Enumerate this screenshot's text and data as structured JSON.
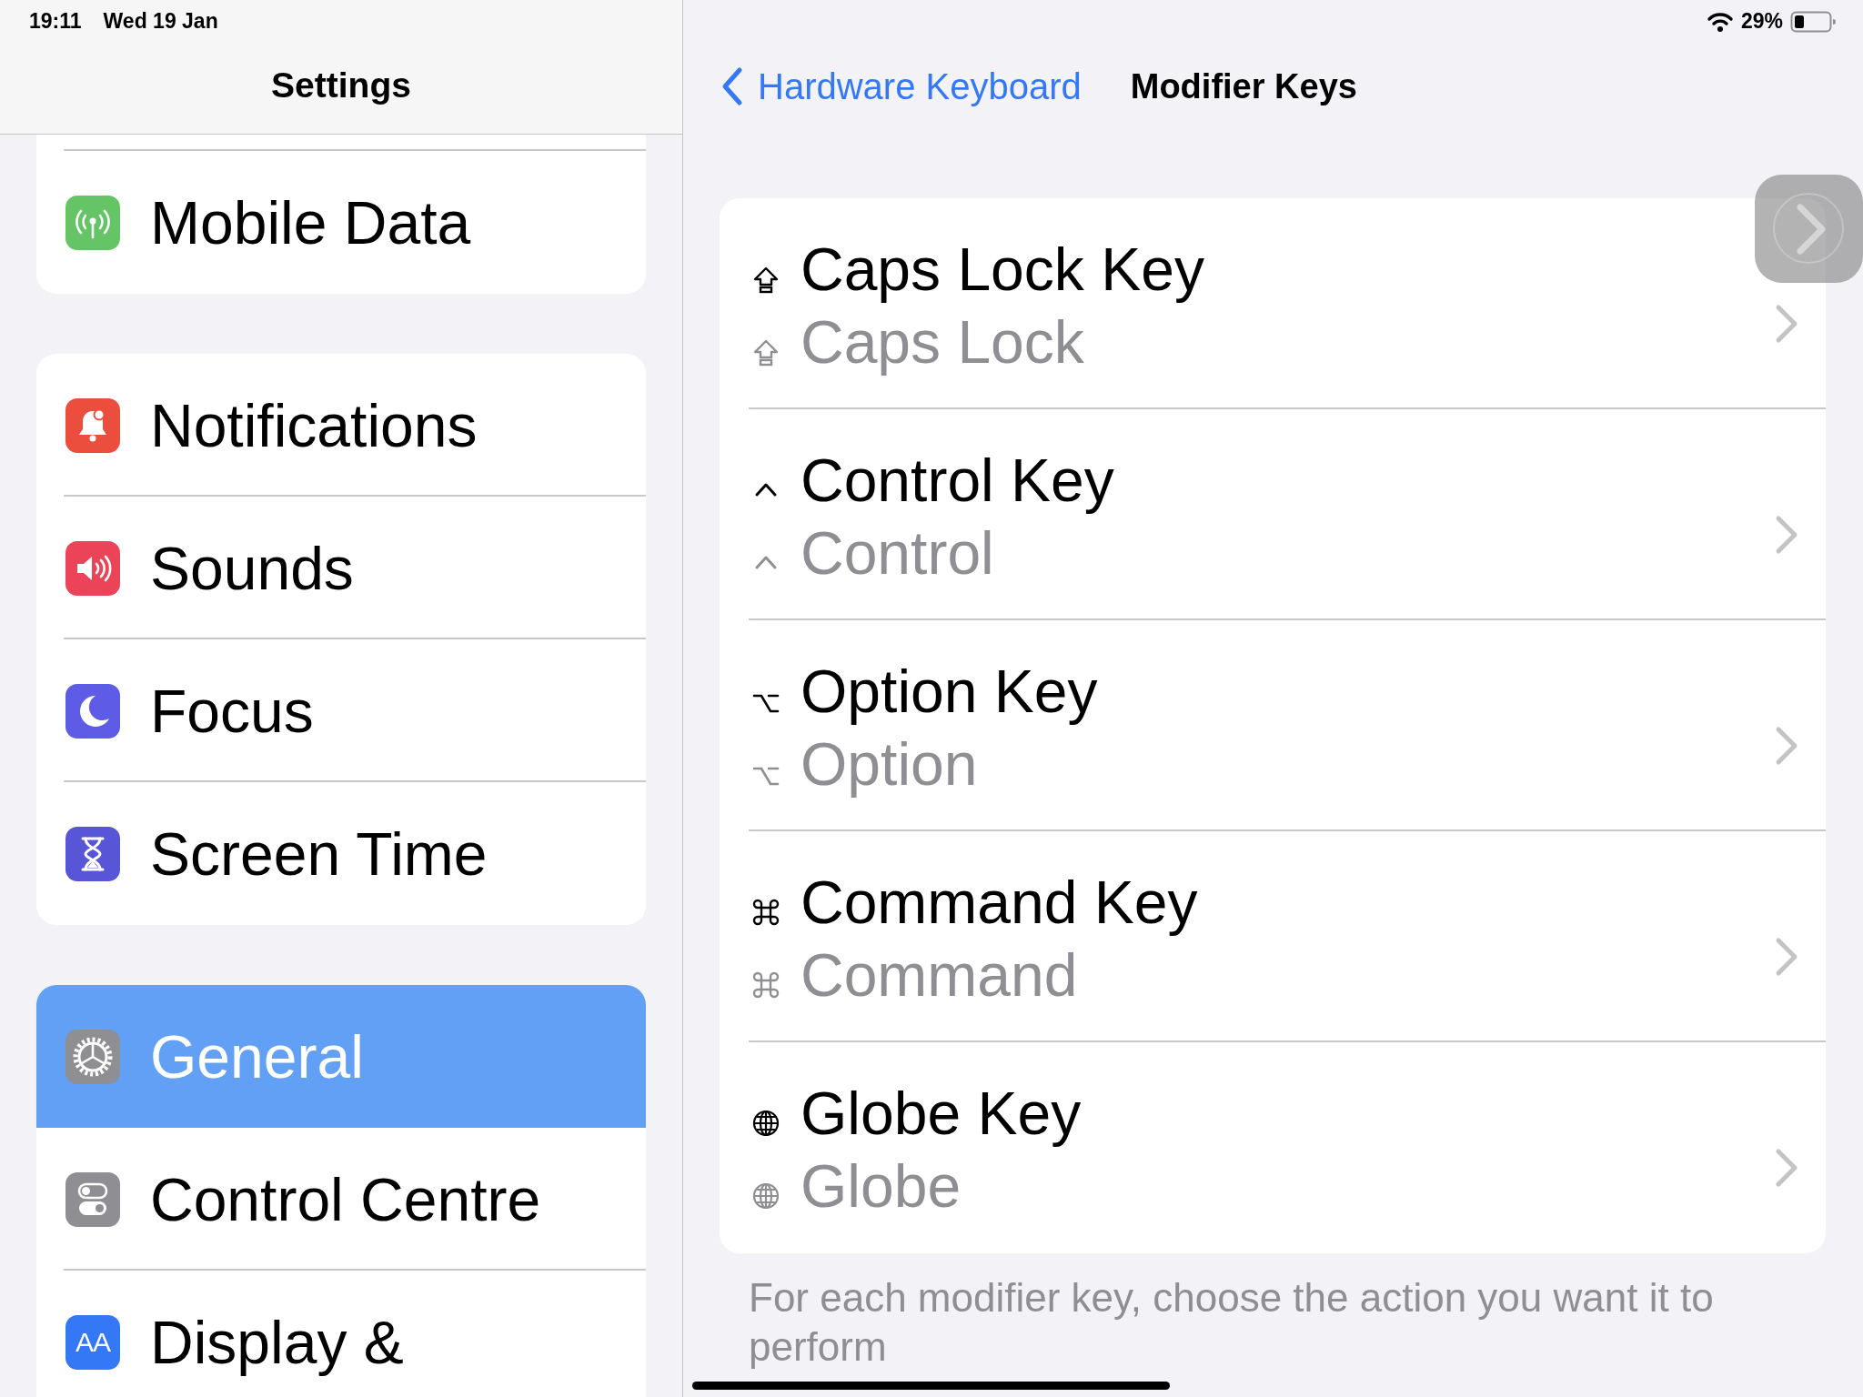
{
  "status_bar": {
    "time": "19:11",
    "date": "Wed 19 Jan",
    "battery": "29%"
  },
  "sidebar": {
    "title": "Settings",
    "groups": [
      {
        "continued": true,
        "items": [
          {
            "label": "Mobile Data",
            "kind": "cellular",
            "color": "#65c466",
            "selected": false
          }
        ]
      },
      {
        "continued": false,
        "items": [
          {
            "label": "Notifications",
            "kind": "bell",
            "color": "#eb4e3d",
            "selected": false
          },
          {
            "label": "Sounds",
            "kind": "speaker",
            "color": "#eb4459",
            "selected": false
          },
          {
            "label": "Focus",
            "kind": "moon",
            "color": "#5e5ce6",
            "selected": false
          },
          {
            "label": "Screen Time",
            "kind": "hourglass",
            "color": "#5856d6",
            "selected": false
          }
        ]
      },
      {
        "continued": false,
        "items": [
          {
            "label": "General",
            "kind": "gear",
            "color": "#8e8e93",
            "selected": true
          },
          {
            "label": "Control Centre",
            "kind": "toggles",
            "color": "#8e8e93",
            "selected": false
          },
          {
            "label": "Display &",
            "kind": "letters",
            "icon_label": "AA",
            "color": "#3478f6",
            "selected": false
          }
        ]
      }
    ]
  },
  "detail": {
    "back": "Hardware Keyboard",
    "title": "Modifier Keys",
    "keys": [
      {
        "kind": "caps_lock",
        "title": "Caps Lock Key",
        "value": "Caps Lock"
      },
      {
        "kind": "control",
        "title": "Control Key",
        "value": "Control"
      },
      {
        "kind": "option",
        "title": "Option Key",
        "value": "Option"
      },
      {
        "kind": "command",
        "title": "Command Key",
        "value": "Command"
      },
      {
        "kind": "globe",
        "title": "Globe Key",
        "value": "Globe"
      }
    ],
    "footer": "For each modifier key, choose the action you want it to perform"
  }
}
